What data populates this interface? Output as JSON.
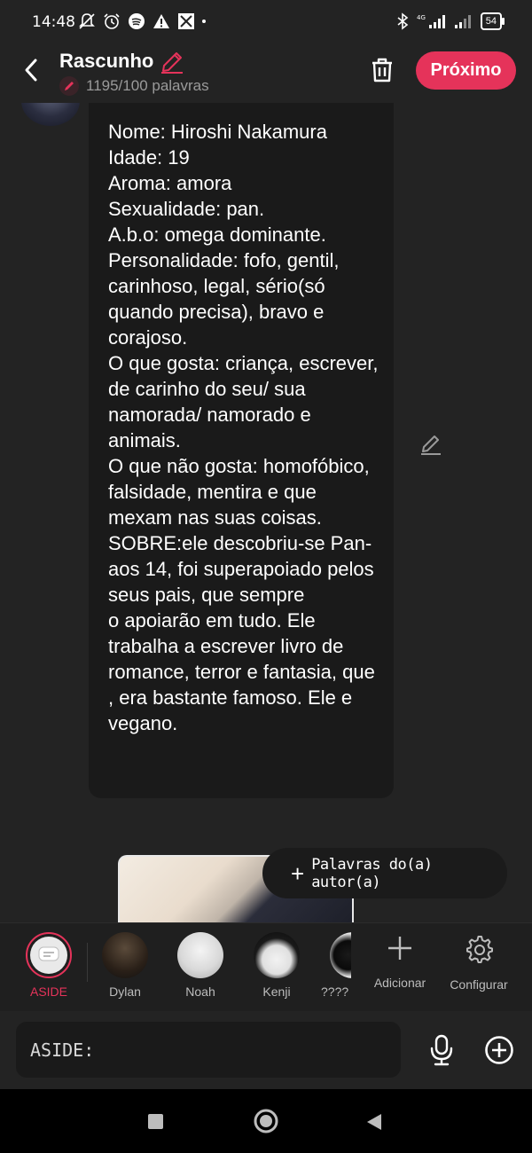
{
  "status_bar": {
    "time": "14:48",
    "battery": "54",
    "icons_left": [
      "mute-bell-icon",
      "alarm-icon",
      "spotify-icon",
      "warning-icon",
      "app-icon",
      "dot-icon"
    ],
    "icons_right": [
      "bluetooth-icon",
      "signal-4g-icon",
      "signal-icon",
      "battery-icon"
    ]
  },
  "header": {
    "title": "Rascunho",
    "word_count": "1195/100 palavras",
    "next_label": "Próximo",
    "accent_color": "#e5335a"
  },
  "message": {
    "text": "Nome: Hiroshi Nakamura\nIdade: 19\nAroma: amora\nSexualidade: pan.\nA.b.o: omega dominante.\nPersonalidade: fofo, gentil, carinhoso, legal, sério(só quando precisa), bravo e corajoso.\nO que gosta: criança, escrever, de carinho do seu/ sua namorada/ namorado e animais.\nO que não gosta: homofóbico, falsidade, mentira e que mexam nas suas coisas.\nSOBRE:ele descobriu-se Pan-aos 14, foi superapoiado pelos\nseus pais, que sempre\no apoiarão em tudo. Ele trabalha a escrever livro de romance, terror e fantasia, que , era bastante famoso. Ele e vegano."
  },
  "author_button": {
    "label": "Palavras do(a) autor(a)"
  },
  "characters": [
    {
      "name": "ASIDE",
      "active": true
    },
    {
      "name": "Dylan"
    },
    {
      "name": "Noah"
    },
    {
      "name": "Kenji"
    },
    {
      "name": "????"
    }
  ],
  "actions": {
    "add_label": "Adicionar",
    "settings_label": "Configurar"
  },
  "input": {
    "placeholder": "ASIDE:"
  }
}
